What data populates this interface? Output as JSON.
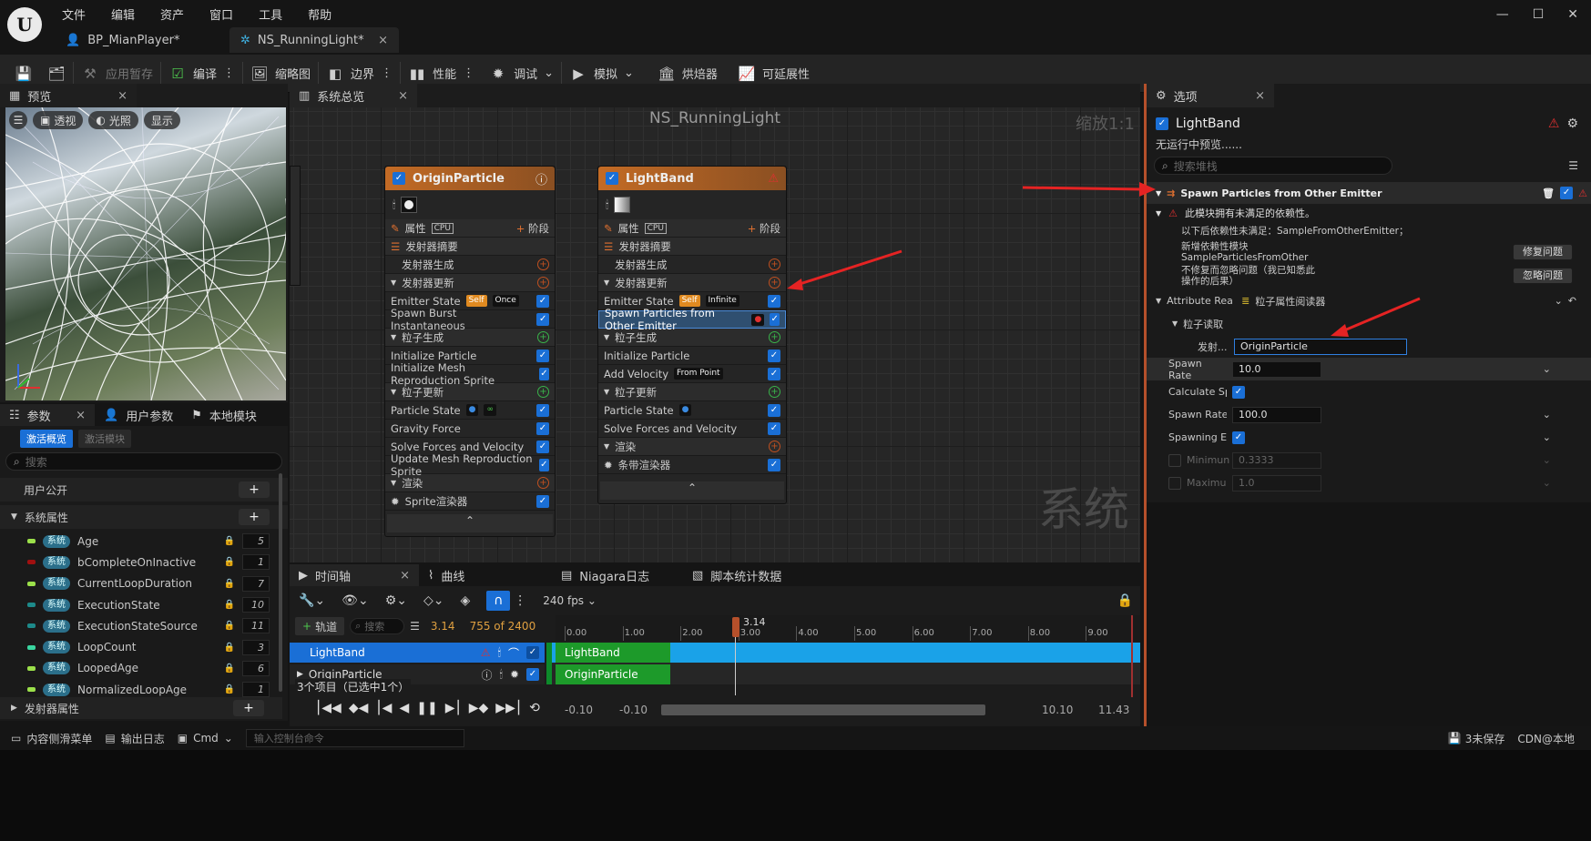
{
  "menu": [
    "文件",
    "编辑",
    "资产",
    "窗口",
    "工具",
    "帮助"
  ],
  "doc_tabs": [
    {
      "label": "BP_MianPlayer*",
      "active": false
    },
    {
      "label": "NS_RunningLight*",
      "active": true
    }
  ],
  "toolbar": {
    "apply_pending": "应用暂存",
    "compile": "编译",
    "thumbnail": "缩略图",
    "bounds": "边界",
    "performance": "性能",
    "debug": "调试",
    "simulate": "模拟",
    "baker": "烘焙器",
    "scalability": "可延展性"
  },
  "preview": {
    "tab": "预览",
    "perspective": "透视",
    "lit": "光照",
    "show": "显示"
  },
  "system_overview": {
    "tab": "系统总览",
    "title": "NS_RunningLight",
    "zoom": "缩放1:1",
    "watermark": "系统"
  },
  "origin_node": {
    "title": "OriginParticle",
    "properties": "属性",
    "cpu": "CPU",
    "stage": "阶段",
    "rows": [
      {
        "label": "发射器摘要",
        "kind": "section"
      },
      {
        "label": "发射器生成",
        "kind": "sub",
        "plus": "orange"
      },
      {
        "label": "发射器更新",
        "kind": "sec",
        "plus": "orange"
      },
      {
        "label": "Emitter State",
        "tag1": "Self",
        "tag2": "Once",
        "kind": "item"
      },
      {
        "label": "Spawn Burst Instantaneous",
        "kind": "item"
      },
      {
        "label": "粒子生成",
        "kind": "sec",
        "plus": "green"
      },
      {
        "label": "Initialize Particle",
        "kind": "item"
      },
      {
        "label": "Initialize Mesh Reproduction Sprite",
        "kind": "item"
      },
      {
        "label": "粒子更新",
        "kind": "sec",
        "plus": "green"
      },
      {
        "label": "Particle State",
        "tag3": "∞",
        "kind": "item"
      },
      {
        "label": "Gravity Force",
        "kind": "item"
      },
      {
        "label": "Solve Forces and Velocity",
        "kind": "item"
      },
      {
        "label": "Update Mesh Reproduction Sprite",
        "kind": "item"
      },
      {
        "label": "渲染",
        "kind": "sec",
        "plus": "orange"
      },
      {
        "label": "Sprite渲染器",
        "kind": "render"
      }
    ]
  },
  "lightband_node": {
    "title": "LightBand",
    "properties": "属性",
    "cpu": "CPU",
    "stage": "阶段",
    "rows": [
      {
        "label": "发射器摘要",
        "kind": "section"
      },
      {
        "label": "发射器生成",
        "kind": "sub",
        "plus": "orange"
      },
      {
        "label": "发射器更新",
        "kind": "sec",
        "plus": "orange"
      },
      {
        "label": "Emitter State",
        "tag1": "Self",
        "tag2": "Infinite",
        "kind": "item"
      },
      {
        "label": "Spawn Particles from Other Emitter",
        "kind": "selected"
      },
      {
        "label": "粒子生成",
        "kind": "sec",
        "plus": "green"
      },
      {
        "label": "Initialize Particle",
        "kind": "item"
      },
      {
        "label": "Add Velocity",
        "tag2": "From Point",
        "kind": "item"
      },
      {
        "label": "粒子更新",
        "kind": "sec",
        "plus": "green"
      },
      {
        "label": "Particle State",
        "kind": "item"
      },
      {
        "label": "Solve Forces and Velocity",
        "kind": "item"
      },
      {
        "label": "渲染",
        "kind": "sec",
        "plus": "orange"
      },
      {
        "label": "条带渲染器",
        "kind": "render"
      }
    ]
  },
  "params": {
    "tabs": [
      "参数",
      "用户参数",
      "本地模块"
    ],
    "subtabs": [
      "激活概览",
      "激活模块"
    ],
    "search_placeholder": "搜索",
    "user_exposed": "用户公开",
    "system_attrs": "系统属性",
    "emitter_attrs": "发射器属性",
    "sys_label": "系统",
    "items": [
      {
        "name": "Age",
        "value": "5",
        "color": "#9be04a"
      },
      {
        "name": "bCompleteOnInactive",
        "value": "1",
        "color": "#a01010"
      },
      {
        "name": "CurrentLoopDuration",
        "value": "7",
        "color": "#9be04a"
      },
      {
        "name": "ExecutionState",
        "value": "10",
        "color": "#1d8a8a"
      },
      {
        "name": "ExecutionStateSource",
        "value": "11",
        "color": "#1d8a8a"
      },
      {
        "name": "LoopCount",
        "value": "3",
        "color": "#3ad6a0"
      },
      {
        "name": "LoopedAge",
        "value": "6",
        "color": "#9be04a"
      },
      {
        "name": "NormalizedLoopAge",
        "value": "1",
        "color": "#9be04a"
      }
    ]
  },
  "timeline": {
    "tabs": [
      "时间轴",
      "曲线",
      "Niagara日志",
      "脚本统计数据"
    ],
    "fps": "240 fps",
    "add_track": "轨道",
    "search_placeholder": "搜索",
    "current_time": "3.14",
    "frame": "755 of 2400",
    "ticks": [
      "0.00",
      "1.00",
      "2.00",
      "3.00",
      "4.00",
      "5.00",
      "6.00",
      "7.00",
      "8.00",
      "9.00"
    ],
    "tracks": [
      {
        "name": "LightBand"
      },
      {
        "name": "OriginParticle"
      }
    ],
    "selection_info": "3个项目（已选中1个）",
    "range_start_a": "-0.10",
    "range_start_b": "-0.10",
    "range_end_a": "10.10",
    "range_end_b": "11.43"
  },
  "details": {
    "tab": "选项",
    "emitter_name": "LightBand",
    "no_preview": "无运行中预览......",
    "search_placeholder": "搜索堆栈",
    "module_title": "Spawn Particles from Other Emitter",
    "warn_title": "此模块拥有未满足的依赖性。",
    "dep_line": "以下后依赖性未满足：SampleFromOtherEmitter；",
    "new_dep": "新增依赖性模块 SampleParticlesFromOther",
    "fix_button": "修复问题",
    "ignore_text": "不修复而忽略问题（我已知悉此操作的后果）",
    "ignore_button": "忽略问题",
    "attr_reader": "Attribute Rea",
    "attr_reader_value": "粒子属性阅读器",
    "particle_read": "粒子读取",
    "emitter_field": "发射...",
    "emitter_value": "OriginParticle",
    "spawn_rate": "Spawn Rate",
    "spawn_rate_value": "10.0",
    "calc_spawn": "Calculate Spa",
    "spawn_rate_f": "Spawn Rate F",
    "spawn_rate_f_value": "100.0",
    "spawning_en": "Spawning Ena",
    "minimum": "Minimun",
    "minimum_value": "0.3333",
    "maximum": "Maximu",
    "maximum_value": "1.0"
  },
  "statusbar": {
    "content": "内容侧滑菜单",
    "output": "输出日志",
    "cmd": "Cmd",
    "console_placeholder": "输入控制台命令",
    "unsaved": "3未保存",
    "source_control": "CDN@本地"
  }
}
